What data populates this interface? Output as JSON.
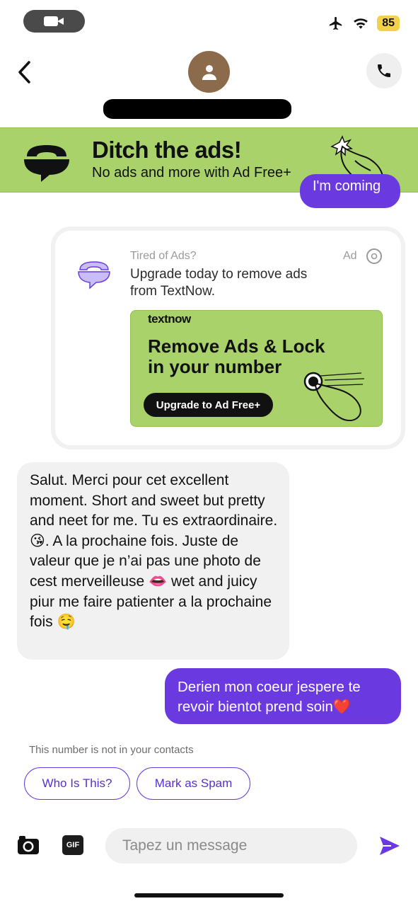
{
  "status_bar": {
    "battery_level": "85",
    "icons": [
      "video-camera-icon",
      "airplane-icon",
      "wifi-icon",
      "battery-icon"
    ]
  },
  "header": {
    "back_icon": "chevron-left-icon",
    "avatar_icon": "person-icon",
    "call_icon": "phone-icon",
    "contact_name": ""
  },
  "banner_ad": {
    "title": "Ditch the ads!",
    "subtitle": "No ads and more with Ad Free+"
  },
  "clipped_message": {
    "text": "I'm coming"
  },
  "ad_card": {
    "tired": "Tired of Ads?",
    "text": "Upgrade today to remove ads from TextNow.",
    "label": "Ad",
    "creative": {
      "brand": "textnow",
      "headline": "Remove Ads & Lock in your number",
      "cta": "Upgrade to Ad Free+"
    }
  },
  "messages": {
    "received": "Salut. Merci pour cet excellent moment. Short and sweet but pretty and neet for me. Tu es extraordinaire. 😘. A la prochaine fois. Juste de valeur que je n’ai pas une photo de cest merveilleuse 👄 wet and juicy piur me faire patienter a la prochaine fois 🤤",
    "sent": "Derien mon coeur jespere te revoir bientot prend soin❤️"
  },
  "contact_notice": {
    "text": "This number is not in your contacts",
    "who_is_this": "Who Is This?",
    "mark_spam": "Mark as Spam"
  },
  "composer": {
    "placeholder": "Tapez un message",
    "gif_label": "GIF"
  },
  "colors": {
    "accent": "#6a3ae0",
    "banner_green": "#a9d36a",
    "received_bubble": "#f1f1f2"
  }
}
